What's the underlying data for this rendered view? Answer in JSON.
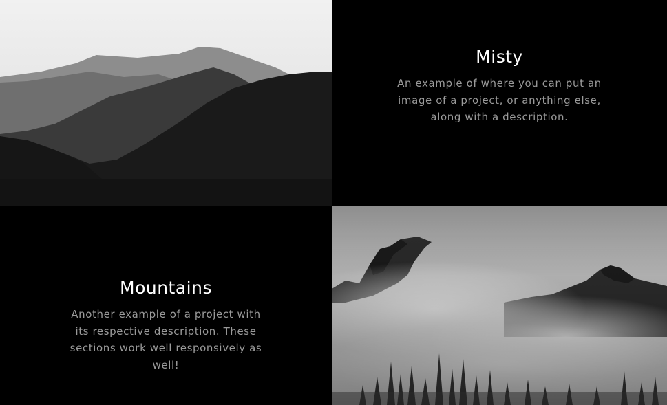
{
  "sections": [
    {
      "title": "Misty",
      "description": "An example of where you can put an image of a project, or anything else, along with a description."
    },
    {
      "title": "Mountains",
      "description": "Another example of a project with its respective description. These sections work well responsively as well!"
    }
  ]
}
